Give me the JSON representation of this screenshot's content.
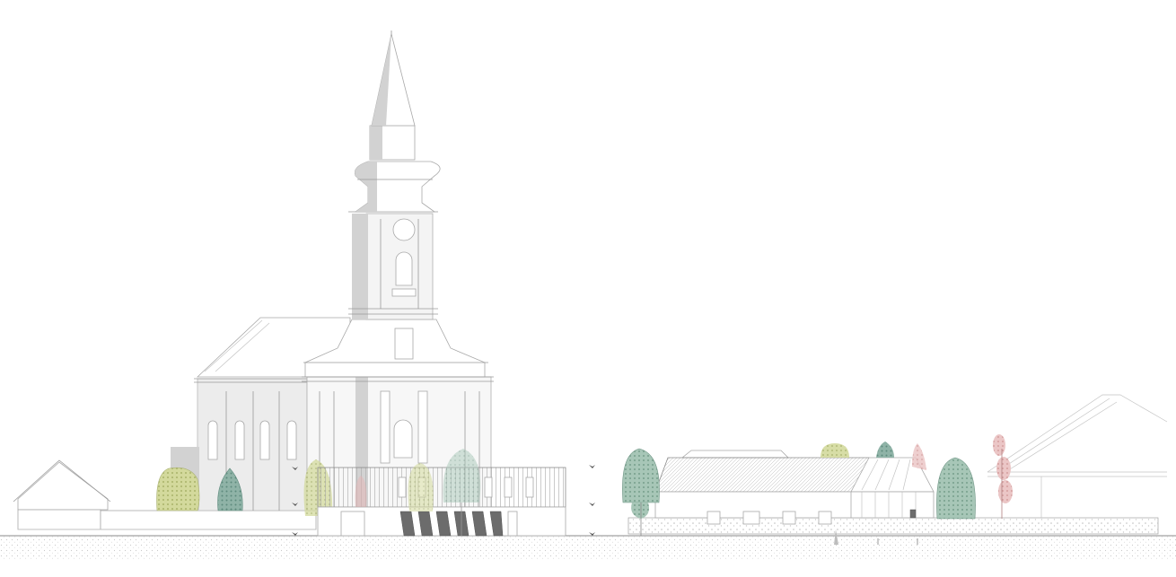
{
  "colors": {
    "background": "#ffffff",
    "line": "#9a9a9a",
    "church_wall": "#ececec",
    "church_shadow": "#d2d2d2",
    "tree_yellow_green": "#c9d08a",
    "tree_teal": "#7fa79b",
    "tree_green": "#8fb5a5",
    "tree_pink": "#e2b3b3",
    "ground": "#f2f2f2"
  },
  "icons": [
    "person-figure-icon",
    "bird-icon"
  ]
}
